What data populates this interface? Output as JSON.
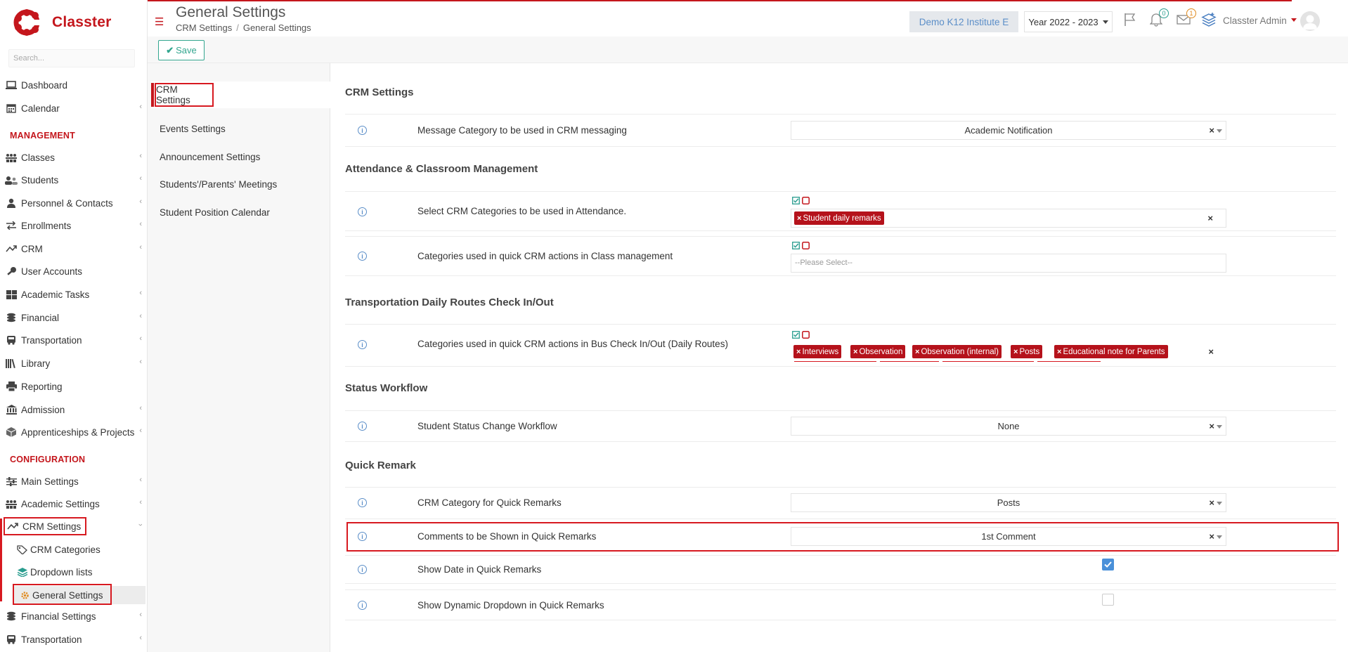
{
  "app": {
    "name": "Classter"
  },
  "sidebar": {
    "search_placeholder": "Search...",
    "items": [
      {
        "label": "Dashboard"
      },
      {
        "label": "Calendar"
      },
      {
        "label": "Classes"
      },
      {
        "label": "Students"
      },
      {
        "label": "Personnel & Contacts"
      },
      {
        "label": "Enrollments"
      },
      {
        "label": "CRM"
      },
      {
        "label": "User Accounts"
      },
      {
        "label": "Academic Tasks"
      },
      {
        "label": "Financial"
      },
      {
        "label": "Transportation"
      },
      {
        "label": "Library"
      },
      {
        "label": "Reporting"
      },
      {
        "label": "Admission"
      },
      {
        "label": "Apprenticeships & Projects"
      },
      {
        "label": "Main Settings"
      },
      {
        "label": "Academic Settings"
      },
      {
        "label": "CRM Settings"
      },
      {
        "label": "Financial Settings"
      },
      {
        "label": "Transportation"
      }
    ],
    "headers": {
      "management": "MANAGEMENT",
      "configuration": "CONFIGURATION"
    },
    "sub_items": [
      {
        "label": "CRM Categories"
      },
      {
        "label": "Dropdown lists"
      },
      {
        "label": "General Settings"
      }
    ]
  },
  "header": {
    "title": "General Settings",
    "breadcrumb": [
      "CRM Settings",
      "General Settings"
    ],
    "institute": "Demo K12 Institute E",
    "year": "Year 2022 - 2023",
    "notifications_count": "0",
    "messages_count": "1",
    "user": "Classter Admin"
  },
  "toolbar": {
    "save_label": "Save"
  },
  "settings_menu": [
    {
      "label": "CRM Settings"
    },
    {
      "label": "Events Settings"
    },
    {
      "label": "Announcement Settings"
    },
    {
      "label": "Students'/Parents' Meetings"
    },
    {
      "label": "Student Position Calendar"
    }
  ],
  "sections": {
    "crm": {
      "title": "CRM Settings",
      "message_category": {
        "label": "Message Category to be used in CRM messaging",
        "value": "Academic Notification"
      }
    },
    "attendance": {
      "title": "Attendance & Classroom Management",
      "attendance_categories": {
        "label": "Select CRM Categories to be used in Attendance.",
        "tags": [
          "Student daily remarks"
        ]
      },
      "class_categories": {
        "label": "Categories used in quick CRM actions in Class management",
        "placeholder": "--Please Select--"
      }
    },
    "transportation": {
      "title": "Transportation Daily Routes Check In/Out",
      "bus_categories": {
        "label": "Categories used in quick CRM actions in Bus Check In/Out (Daily Routes)",
        "tags": [
          "Interviews",
          "Observation",
          "Observation (internal)",
          "Posts",
          "Educational note for Parents"
        ]
      }
    },
    "status": {
      "title": "Status Workflow",
      "status_change": {
        "label": "Student Status Change Workflow",
        "value": "None"
      }
    },
    "quick_remark": {
      "title": "Quick Remark",
      "category": {
        "label": "CRM Category for Quick Remarks",
        "value": "Posts"
      },
      "comments": {
        "label": "Comments to be Shown in Quick Remarks",
        "value": "1st Comment"
      },
      "show_date": {
        "label": "Show Date in Quick Remarks",
        "checked": true
      },
      "show_dropdown": {
        "label": "Show Dynamic Dropdown in Quick Remarks",
        "checked": false
      }
    }
  },
  "colors": {
    "brand": "#c4161c",
    "accent": "#33a68f",
    "info": "#5b8ec8",
    "tag": "#b5121b"
  }
}
